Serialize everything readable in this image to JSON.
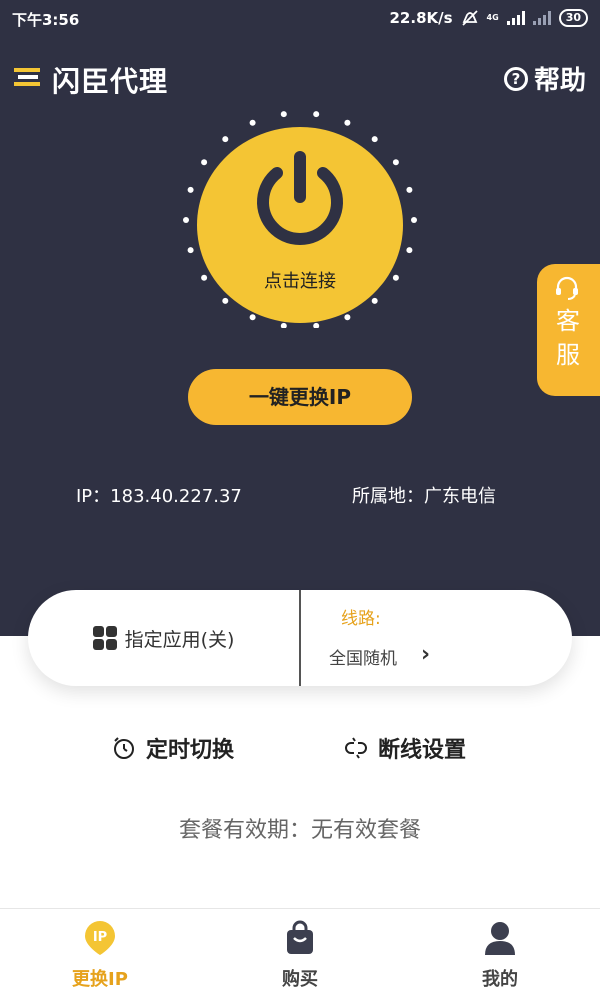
{
  "status_bar": {
    "time": "下午3:56",
    "net_speed": "22.8K/s",
    "network": "4G",
    "battery": "30"
  },
  "header": {
    "title": "闪臣代理",
    "help_label": "帮助"
  },
  "power": {
    "label": "点击连接"
  },
  "change_ip_label": "一键更换IP",
  "ip_info": {
    "ip_text": "IP：183.40.227.37",
    "location_text": "所属地：广东电信"
  },
  "card": {
    "app_select_label": "指定应用(关)",
    "route_label": "线路:",
    "route_value": "全国随机"
  },
  "options": {
    "timer_label": "定时切换",
    "disconnect_label": "断线设置"
  },
  "validity_text": "套餐有效期：无有效套餐",
  "customer_service_label": "客服",
  "tabs": [
    {
      "label": "更换IP",
      "icon": "ip-pin-icon",
      "active": true
    },
    {
      "label": "购买",
      "icon": "shopping-bag-icon",
      "active": false
    },
    {
      "label": "我的",
      "icon": "user-icon",
      "active": false
    }
  ],
  "colors": {
    "dark_bg": "#2f3143",
    "accent_yellow": "#f4c534",
    "button_orange": "#f7b731",
    "accent_text": "#e6a21c"
  }
}
